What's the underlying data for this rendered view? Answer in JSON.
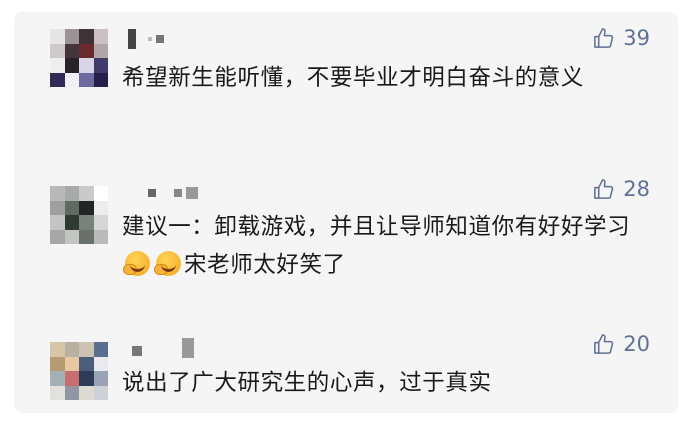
{
  "comments": [
    {
      "text": "希望新生能听懂，不要毕业才明白奋斗的意义",
      "likes": "39",
      "like_icon": "thumbs-up-icon"
    },
    {
      "text_part1": "建议一：卸载游戏，并且让导师知道你有好好学习",
      "text_part2": "宋老师太好笑了",
      "emoji": "laughing-crying-emoji",
      "likes": "28",
      "like_icon": "thumbs-up-icon"
    },
    {
      "text": "说出了广大研究生的心声，过于真实",
      "likes": "20",
      "like_icon": "thumbs-up-icon"
    }
  ],
  "colors": {
    "like": "#5f6f95",
    "text": "#1a1a1a",
    "card": "#f5f5f5"
  }
}
